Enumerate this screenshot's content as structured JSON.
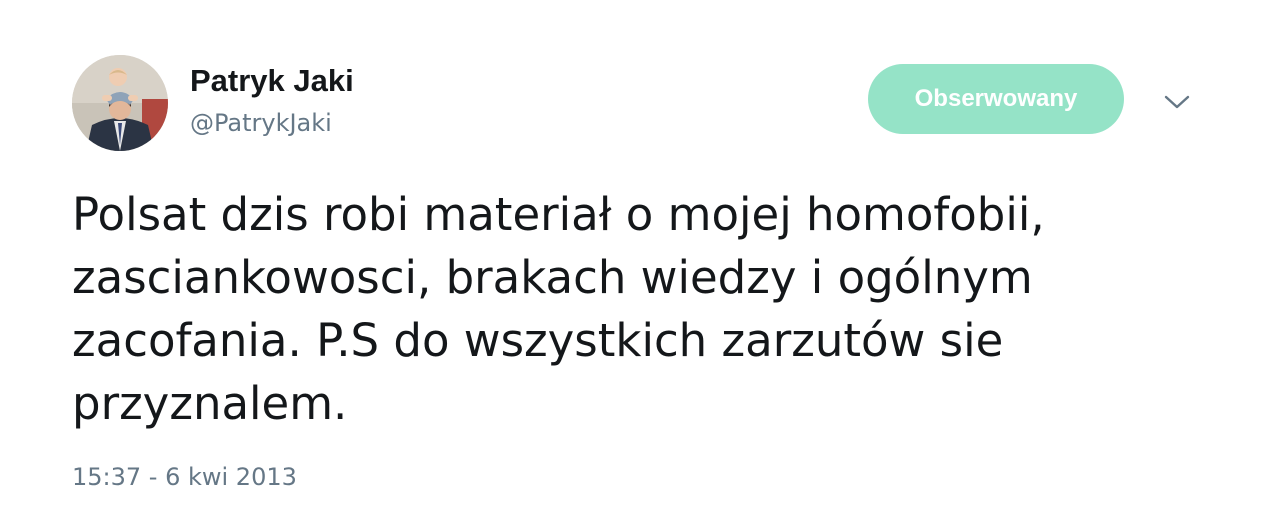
{
  "tweet": {
    "author": {
      "name": "Patryk Jaki",
      "handle": "@PatrykJaki",
      "avatar_icon": "profile-photo"
    },
    "follow_button_label": "Obserwowany",
    "menu_icon": "chevron-down-icon",
    "text": "Polsat dzis robi materiał o mojej homofobii,\nzasciankowosci, brakach wiedzy i ogólnym\nzacofania. P.S do wszystkich zarzutów sie\nprzyznalem.",
    "timestamp": "15:37 - 6 kwi 2013",
    "colors": {
      "follow_button_bg": "#95e3c7",
      "secondary_text": "#657786",
      "primary_text": "#14171a"
    }
  }
}
